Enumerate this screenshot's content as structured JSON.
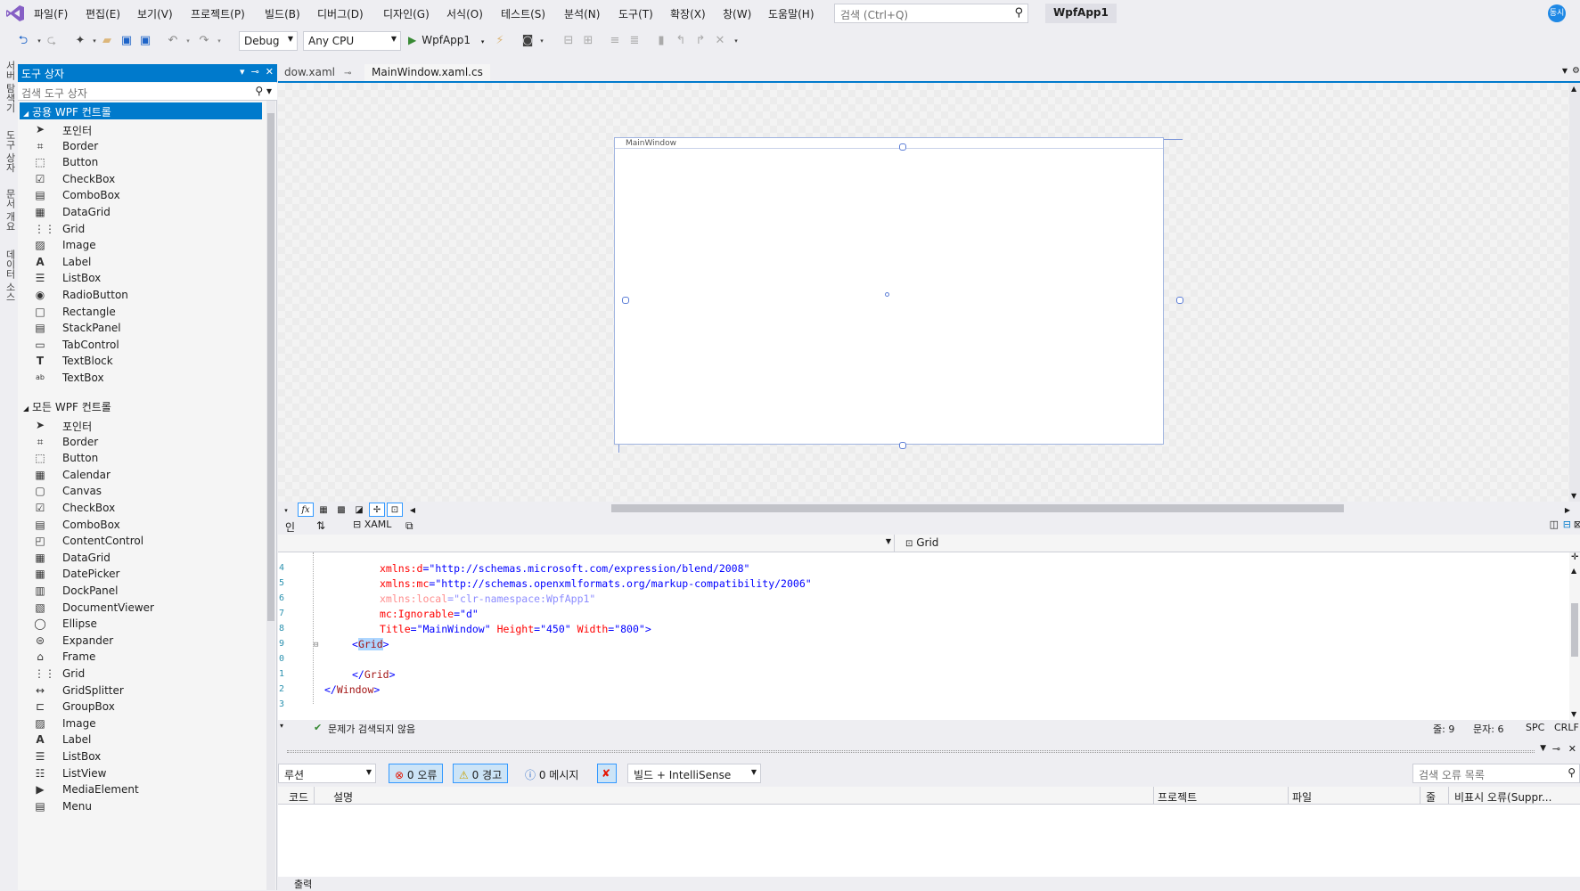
{
  "menubar": {
    "items": [
      "파일(F)",
      "편집(E)",
      "보기(V)",
      "프로젝트(P)",
      "빌드(B)",
      "디버그(D)",
      "디자인(G)",
      "서식(O)",
      "테스트(S)",
      "분석(N)",
      "도구(T)",
      "확장(X)",
      "창(W)",
      "도움말(H)"
    ],
    "search_placeholder": "검색 (Ctrl+Q)",
    "solution_name": "WpfApp1",
    "user_initials": "동시"
  },
  "toolbar": {
    "config": "Debug",
    "platform": "Any CPU",
    "run_target": "WpfApp1"
  },
  "vtabs": [
    "서버 탐색기",
    "도구 상자",
    "문서 개요",
    "데이터 소스"
  ],
  "toolbox": {
    "title": "도구 상자",
    "search_placeholder": "검색 도구 상자",
    "group1": "공용 WPF 컨트롤",
    "group1_items": [
      {
        "label": "포인터",
        "icon": "pointer-icon"
      },
      {
        "label": "Border",
        "icon": "border-icon"
      },
      {
        "label": "Button",
        "icon": "button-icon"
      },
      {
        "label": "CheckBox",
        "icon": "checkbox-icon"
      },
      {
        "label": "ComboBox",
        "icon": "combobox-icon"
      },
      {
        "label": "DataGrid",
        "icon": "datagrid-icon"
      },
      {
        "label": "Grid",
        "icon": "grid-icon"
      },
      {
        "label": "Image",
        "icon": "image-icon"
      },
      {
        "label": "Label",
        "icon": "label-icon"
      },
      {
        "label": "ListBox",
        "icon": "listbox-icon"
      },
      {
        "label": "RadioButton",
        "icon": "radiobutton-icon"
      },
      {
        "label": "Rectangle",
        "icon": "rectangle-icon"
      },
      {
        "label": "StackPanel",
        "icon": "stackpanel-icon"
      },
      {
        "label": "TabControl",
        "icon": "tabcontrol-icon"
      },
      {
        "label": "TextBlock",
        "icon": "textblock-icon"
      },
      {
        "label": "TextBox",
        "icon": "textbox-icon"
      }
    ],
    "group2": "모든 WPF 컨트롤",
    "group2_items": [
      {
        "label": "포인터",
        "icon": "pointer-icon"
      },
      {
        "label": "Border",
        "icon": "border-icon"
      },
      {
        "label": "Button",
        "icon": "button-icon"
      },
      {
        "label": "Calendar",
        "icon": "calendar-icon"
      },
      {
        "label": "Canvas",
        "icon": "canvas-icon"
      },
      {
        "label": "CheckBox",
        "icon": "checkbox-icon"
      },
      {
        "label": "ComboBox",
        "icon": "combobox-icon"
      },
      {
        "label": "ContentControl",
        "icon": "contentcontrol-icon"
      },
      {
        "label": "DataGrid",
        "icon": "datagrid-icon"
      },
      {
        "label": "DatePicker",
        "icon": "datepicker-icon"
      },
      {
        "label": "DockPanel",
        "icon": "dockpanel-icon"
      },
      {
        "label": "DocumentViewer",
        "icon": "documentviewer-icon"
      },
      {
        "label": "Ellipse",
        "icon": "ellipse-icon"
      },
      {
        "label": "Expander",
        "icon": "expander-icon"
      },
      {
        "label": "Frame",
        "icon": "frame-icon"
      },
      {
        "label": "Grid",
        "icon": "grid-icon"
      },
      {
        "label": "GridSplitter",
        "icon": "gridsplitter-icon"
      },
      {
        "label": "GroupBox",
        "icon": "groupbox-icon"
      },
      {
        "label": "Image",
        "icon": "image-icon"
      },
      {
        "label": "Label",
        "icon": "label-icon"
      },
      {
        "label": "ListBox",
        "icon": "listbox-icon"
      },
      {
        "label": "ListView",
        "icon": "listview-icon"
      },
      {
        "label": "MediaElement",
        "icon": "mediaelement-icon"
      },
      {
        "label": "Menu",
        "icon": "menu-icon"
      }
    ]
  },
  "doctabs": {
    "tab1": "dow.xaml",
    "tab2": "MainWindow.xaml.cs"
  },
  "designer": {
    "window_title": "MainWindow"
  },
  "splitbar": {
    "design_tab": "인",
    "xaml_tab": "XAML"
  },
  "code_nav": {
    "element": "Grid"
  },
  "code": {
    "line_numbers": [
      "4",
      "5",
      "6",
      "7",
      "8",
      "9",
      "0",
      "1",
      "2",
      "3"
    ],
    "line4": {
      "attr": "xmlns:d",
      "val": "\"http://schemas.microsoft.com/expression/blend/2008\""
    },
    "line5": {
      "attr": "xmlns:mc",
      "val": "\"http://schemas.openxmlformats.org/markup-compatibility/2006\""
    },
    "line6": {
      "attr": "xmlns:local",
      "val": "\"clr-namespace:WpfApp1\""
    },
    "line7": {
      "attr": "mc:Ignorable",
      "val": "\"d\""
    },
    "line8": {
      "attr1": "Title",
      "val1": "\"MainWindow\"",
      "attr2": "Height",
      "val2": "\"450\"",
      "attr3": "Width",
      "val3": "\"800\""
    },
    "grid_open": "Grid",
    "grid_close": "Grid",
    "window_close": "Window"
  },
  "code_status": {
    "issues": "문제가 검색되지 않음",
    "line": "줄: 9",
    "char": "문자: 6",
    "spc": "SPC",
    "crlf": "CRLF"
  },
  "errlist": {
    "scope": "루션",
    "errors": "0 오류",
    "warnings": "0 경고",
    "messages": "0 메시지",
    "build_filter": "빌드 + IntelliSense",
    "search_placeholder": "검색 오류 목록",
    "columns": [
      "코드",
      "설명",
      "프로젝트",
      "파일",
      "줄",
      "비표시 오류(Suppr..."
    ]
  },
  "output_tab": "출력"
}
